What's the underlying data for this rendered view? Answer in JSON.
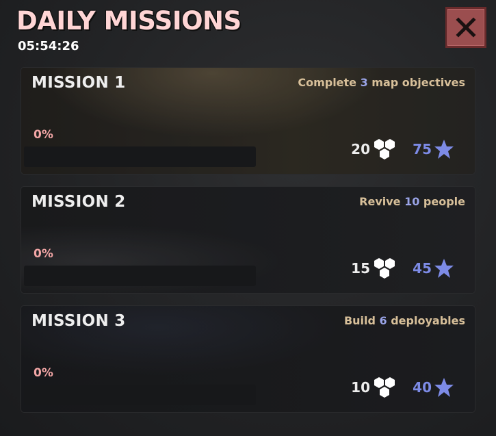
{
  "header": {
    "title": "DAILY MISSIONS",
    "timer": "05:54:26"
  },
  "close_button": {
    "icon": "close-icon",
    "color": "#9b4e4f"
  },
  "missions": [
    {
      "title": "MISSION 1",
      "desc_pre": "Complete ",
      "desc_num": "3",
      "desc_post": " map objectives",
      "progress_label": "0%",
      "progress": 0,
      "reward_cells": "20",
      "reward_stars": "75"
    },
    {
      "title": "MISSION 2",
      "desc_pre": "Revive ",
      "desc_num": "10",
      "desc_post": " people",
      "progress_label": "0%",
      "progress": 0,
      "reward_cells": "15",
      "reward_stars": "45"
    },
    {
      "title": "MISSION 3",
      "desc_pre": "Build ",
      "desc_num": "6",
      "desc_post": " deployables",
      "progress_label": "0%",
      "progress": 0,
      "reward_cells": "10",
      "reward_stars": "40"
    }
  ],
  "colors": {
    "title": "#ffd5d5",
    "description": "#d8c09a",
    "highlight_number": "#9aa4e8",
    "percent": "#f3a6a6",
    "star": "#7d8be6"
  },
  "icons": {
    "cells": "hexagon-cluster-icon",
    "stars": "star-icon"
  }
}
